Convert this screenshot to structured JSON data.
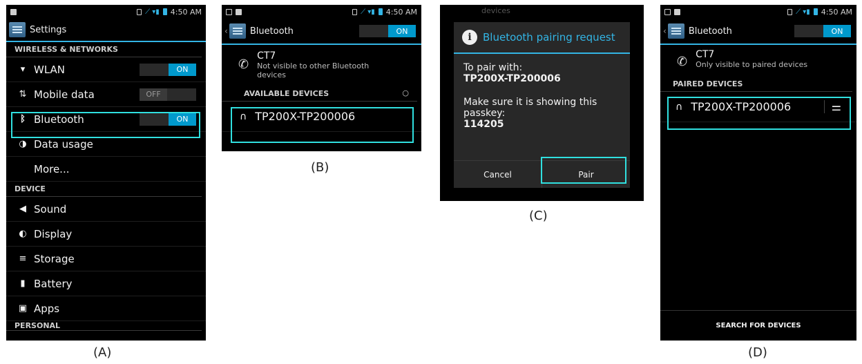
{
  "status": {
    "time": "4:50 AM"
  },
  "panelA": {
    "caption": "(A)",
    "title": "Settings",
    "section_wireless": "WIRELESS & NETWORKS",
    "wlan": {
      "label": "WLAN",
      "toggle": "ON",
      "icon": "wifi-icon"
    },
    "mobile": {
      "label": "Mobile data",
      "toggle": "OFF",
      "icon": "data-arrows-icon"
    },
    "bluetooth": {
      "label": "Bluetooth",
      "toggle": "ON",
      "icon": "bluetooth-icon"
    },
    "data_usage": {
      "label": "Data usage",
      "icon": "pie-icon"
    },
    "more": "More...",
    "section_device": "DEVICE",
    "sound": {
      "label": "Sound",
      "icon": "speaker-icon"
    },
    "display": {
      "label": "Display",
      "icon": "brightness-icon"
    },
    "storage": {
      "label": "Storage",
      "icon": "storage-icon"
    },
    "battery": {
      "label": "Battery",
      "icon": "battery-icon"
    },
    "apps": {
      "label": "Apps",
      "icon": "apps-icon"
    },
    "section_personal": "PERSONAL"
  },
  "panelB": {
    "caption": "(B)",
    "title": "Bluetooth",
    "toggle": "ON",
    "device_name": "CT7",
    "device_sub": "Not visible to other Bluetooth devices",
    "section": "AVAILABLE DEVICES",
    "available_device": "TP200X-TP200006"
  },
  "panelC": {
    "caption": "(C)",
    "bg_text": "devices",
    "dialog_title": "Bluetooth pairing request",
    "pair_with": "To pair with:",
    "device": "TP200X-TP200006",
    "passkey_msg": "Make sure it is showing this passkey:",
    "passkey": "114205",
    "cancel": "Cancel",
    "pair": "Pair"
  },
  "panelD": {
    "caption": "(D)",
    "title": "Bluetooth",
    "toggle": "ON",
    "device_name": "CT7",
    "device_sub": "Only visible to paired devices",
    "section": "PAIRED DEVICES",
    "paired_device": "TP200X-TP200006",
    "search": "SEARCH FOR DEVICES"
  },
  "colors": {
    "accent": "#33b5e5",
    "highlight": "#30e0e0",
    "toggle_on": "#0099cc"
  }
}
